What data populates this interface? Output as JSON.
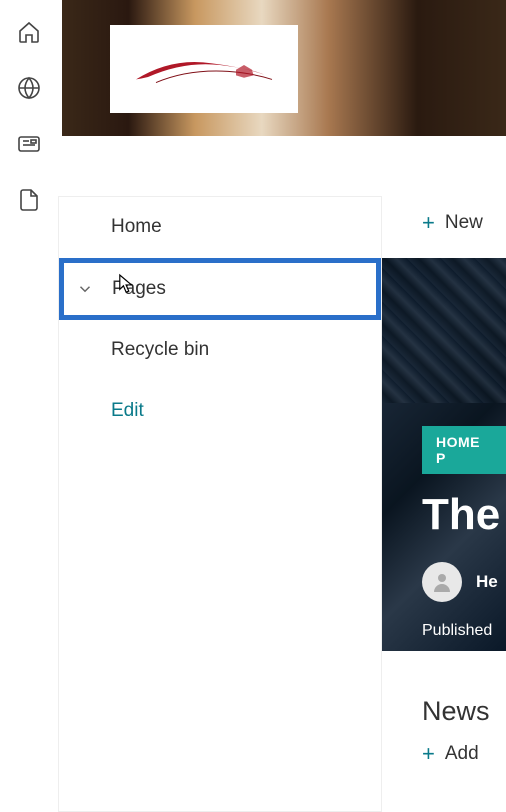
{
  "rail": {
    "icons": [
      "home-icon",
      "globe-icon",
      "news-icon",
      "file-icon"
    ]
  },
  "nav": {
    "home": "Home",
    "pages": "Pages",
    "recycle": "Recycle bin",
    "edit": "Edit"
  },
  "actions": {
    "new": "New",
    "add": "Add"
  },
  "hero": {
    "badge": "HOME P",
    "title": "The",
    "author": "He",
    "published": "Published"
  },
  "news": {
    "heading": "News"
  }
}
